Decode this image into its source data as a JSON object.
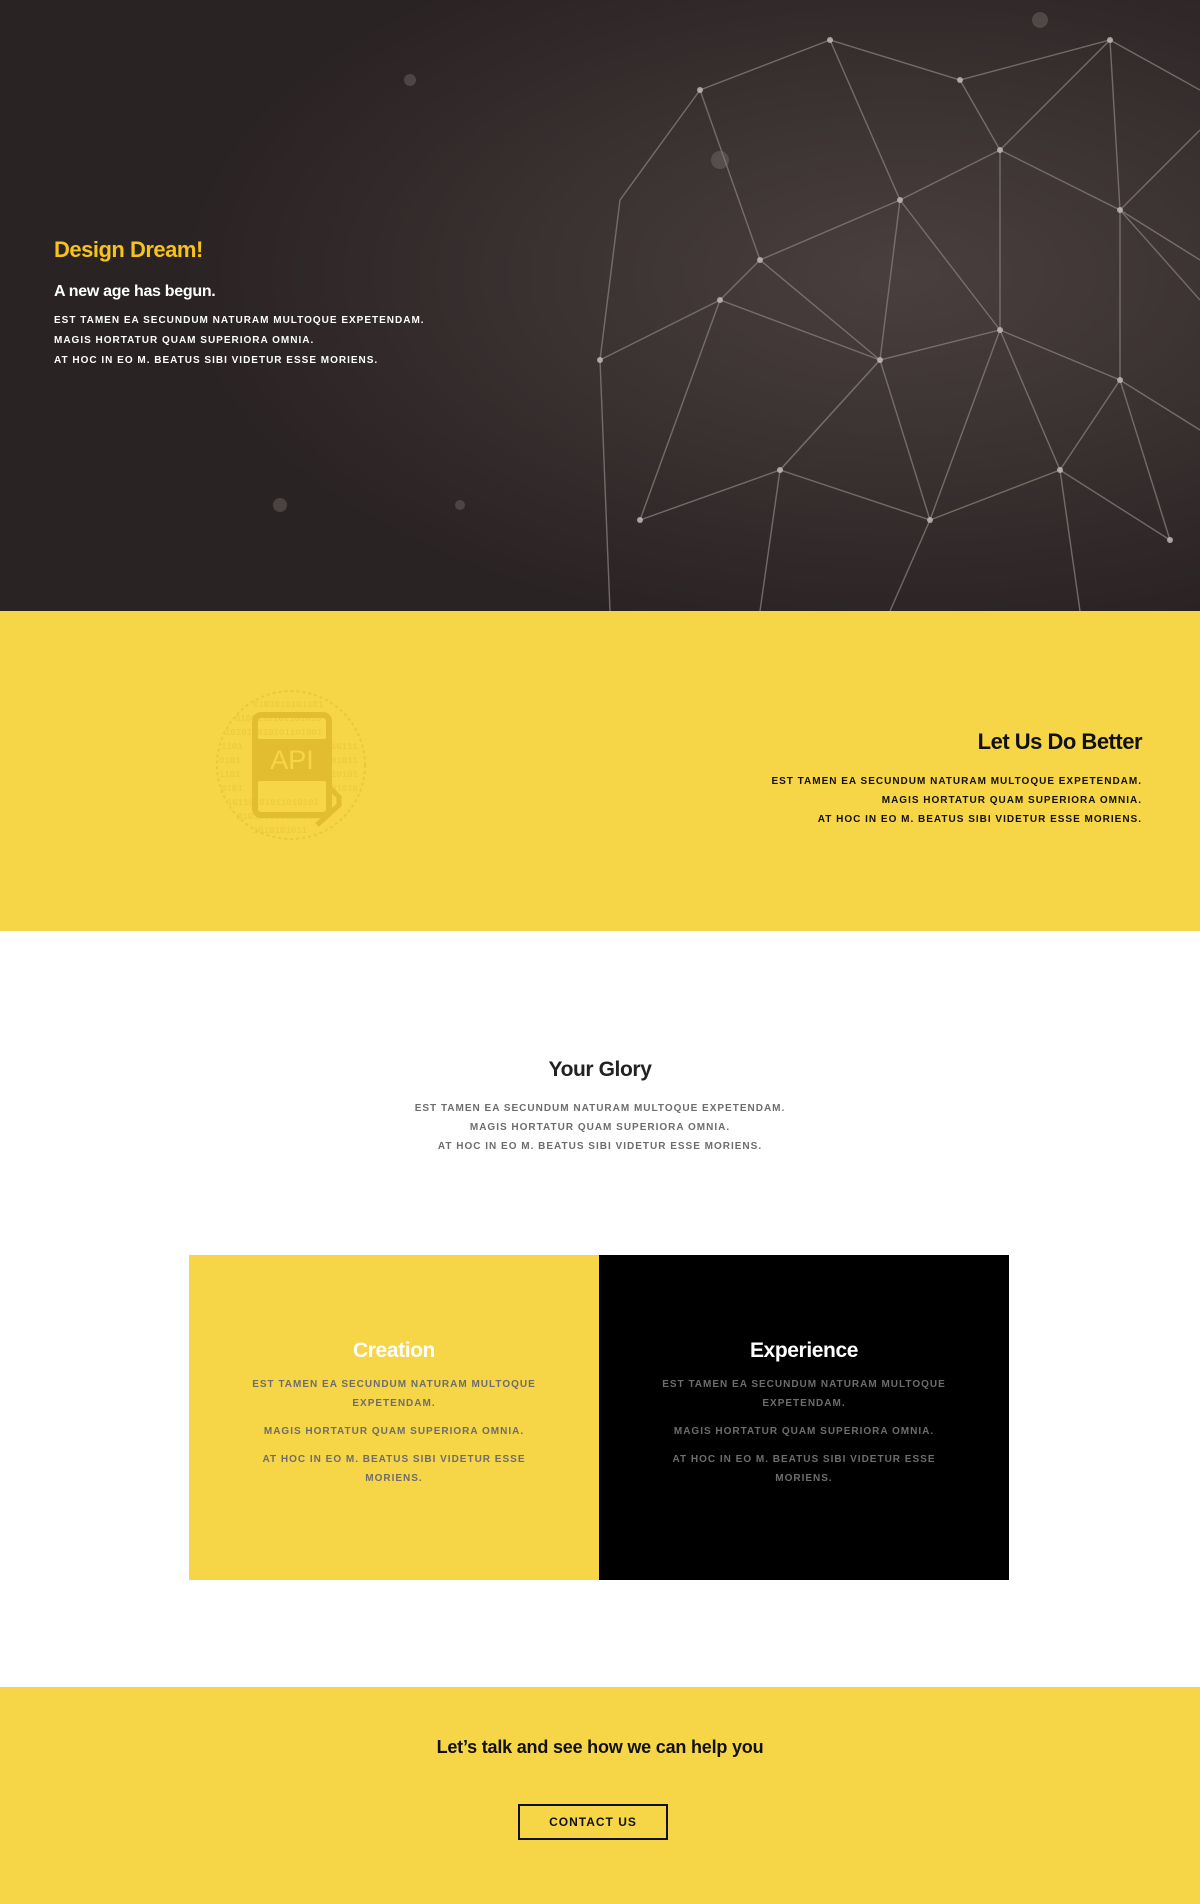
{
  "hero": {
    "title": "Design Dream!",
    "subtitle": "A new age has begun.",
    "lines": [
      "EST TAMEN EA SECUNDUM NATURAM MULTOQUE EXPETENDAM.",
      "MAGIS HORTATUR QUAM SUPERIORA OMNIA.",
      "AT HOC IN EO M. BEATUS SIBI VIDETUR ESSE MORIENS."
    ],
    "accent_color": "#f6c21c",
    "background_color": "#2a2323"
  },
  "better": {
    "logo_text": "API",
    "title": "Let Us Do Better",
    "lines": [
      "EST TAMEN EA SECUNDUM NATURAM MULTOQUE EXPETENDAM.",
      "MAGIS HORTATUR QUAM SUPERIORA OMNIA.",
      "AT HOC IN EO M. BEATUS SIBI VIDETUR ESSE MORIENS."
    ],
    "background_color": "#f6d546"
  },
  "glory": {
    "title": "Your Glory",
    "lines": [
      "EST TAMEN EA SECUNDUM NATURAM MULTOQUE EXPETENDAM.",
      "MAGIS HORTATUR QUAM SUPERIORA OMNIA.",
      "AT HOC IN EO M. BEATUS SIBI VIDETUR ESSE MORIENS."
    ],
    "boxes": [
      {
        "title": "Creation",
        "lines": [
          "EST TAMEN EA SECUNDUM NATURAM MULTOQUE EXPETENDAM.",
          "MAGIS HORTATUR QUAM SUPERIORA OMNIA.",
          "AT HOC IN EO M. BEATUS SIBI VIDETUR ESSE MORIENS."
        ],
        "color": "#f6d546"
      },
      {
        "title": "Experience",
        "lines": [
          "EST TAMEN EA SECUNDUM NATURAM MULTOQUE EXPETENDAM.",
          "MAGIS HORTATUR QUAM SUPERIORA OMNIA.",
          "AT HOC IN EO M. BEATUS SIBI VIDETUR ESSE MORIENS."
        ],
        "color": "#000000"
      }
    ]
  },
  "contact": {
    "title": "Let’s talk and see how we can help you",
    "button_label": "CONTACT US"
  }
}
